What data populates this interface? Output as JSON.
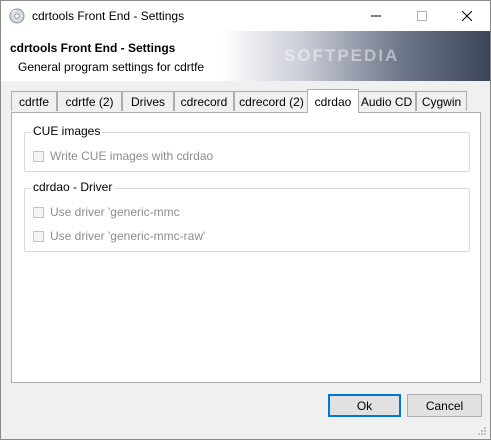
{
  "window": {
    "title": "cdrtools Front End - Settings"
  },
  "header": {
    "title": "cdrtools Front End - Settings",
    "subtitle": "General program settings for cdrtfe",
    "watermark": "SOFTPEDIA"
  },
  "tabs": [
    {
      "label": "cdrtfe"
    },
    {
      "label": "cdrtfe (2)"
    },
    {
      "label": "Drives"
    },
    {
      "label": "cdrecord"
    },
    {
      "label": "cdrecord (2)"
    },
    {
      "label": "cdrdao",
      "active": true
    },
    {
      "label": "Audio CD"
    },
    {
      "label": "Cygwin"
    }
  ],
  "groups": {
    "cue": {
      "label": "CUE images",
      "options": [
        {
          "label": "Write CUE images with cdrdao",
          "checked": false,
          "enabled": false
        }
      ]
    },
    "driver": {
      "label": "cdrdao - Driver",
      "options": [
        {
          "label": "Use driver 'generic-mmc",
          "checked": false,
          "enabled": false
        },
        {
          "label": "Use driver 'generic-mmc-raw'",
          "checked": false,
          "enabled": false
        }
      ]
    }
  },
  "buttons": {
    "ok": "Ok",
    "cancel": "Cancel"
  },
  "colors": {
    "accent": "#0078d7",
    "disabled_text": "#8d8d8d",
    "header_gradient_end": "#3c4459"
  }
}
